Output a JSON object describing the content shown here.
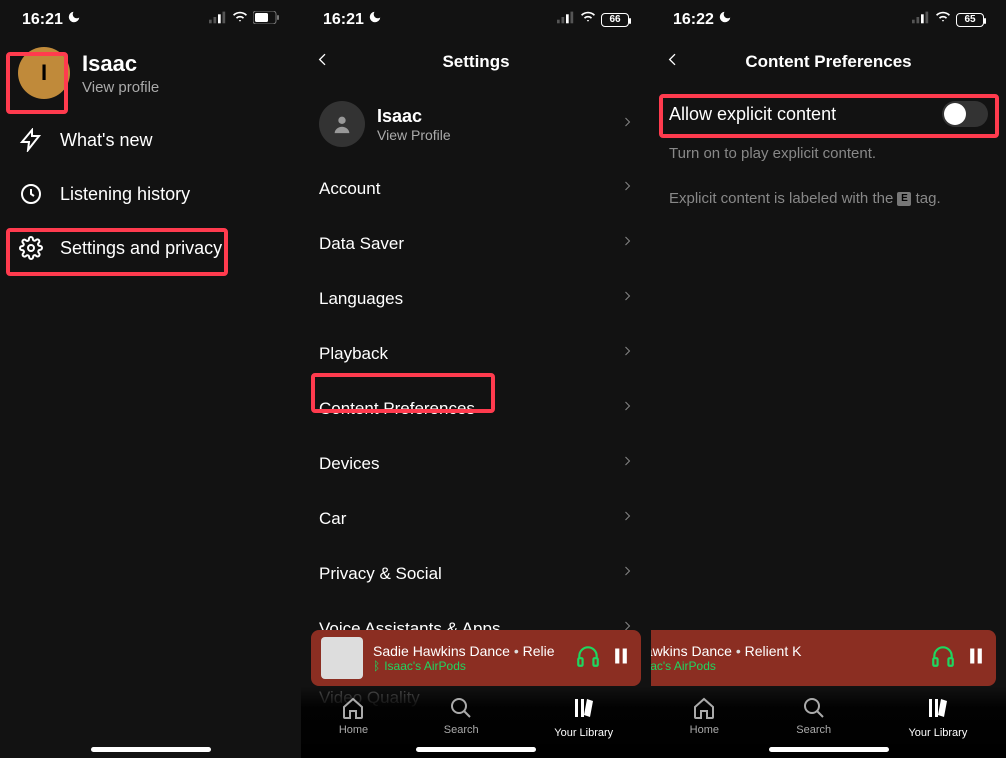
{
  "panel1": {
    "status": {
      "time": "16:21"
    },
    "profile": {
      "initial": "I",
      "name": "Isaac",
      "sub": "View profile"
    },
    "items": {
      "whats_new": "What's new",
      "listening_history": "Listening history",
      "settings_privacy": "Settings and privacy"
    }
  },
  "panel2": {
    "status": {
      "time": "16:21",
      "battery": "66"
    },
    "header": "Settings",
    "profile": {
      "name": "Isaac",
      "sub": "View Profile"
    },
    "items": {
      "account": "Account",
      "data_saver": "Data Saver",
      "languages": "Languages",
      "playback": "Playback",
      "content_preferences": "Content Preferences",
      "devices": "Devices",
      "car": "Car",
      "privacy_social": "Privacy & Social",
      "voice_assistants": "Voice Assistants & Apps",
      "video_quality": "Video Quality"
    }
  },
  "panel3": {
    "status": {
      "time": "16:22",
      "battery": "65"
    },
    "header": "Content Preferences",
    "allow_explicit": "Allow explicit content",
    "sub1": "Turn on to play explicit content.",
    "sub2_a": "Explicit content is labeled with the ",
    "sub2_b": " tag.",
    "e_tag": "E"
  },
  "now_playing": {
    "title_a": "Sadie Hawkins Dance",
    "title_b_p2": "Relie",
    "title_b_p3": "Relient K",
    "title_p3_cut": "e Hawkins Dance",
    "device": "Isaac's AirPods"
  },
  "tabs": {
    "home": "Home",
    "search": "Search",
    "library": "Your Library"
  }
}
